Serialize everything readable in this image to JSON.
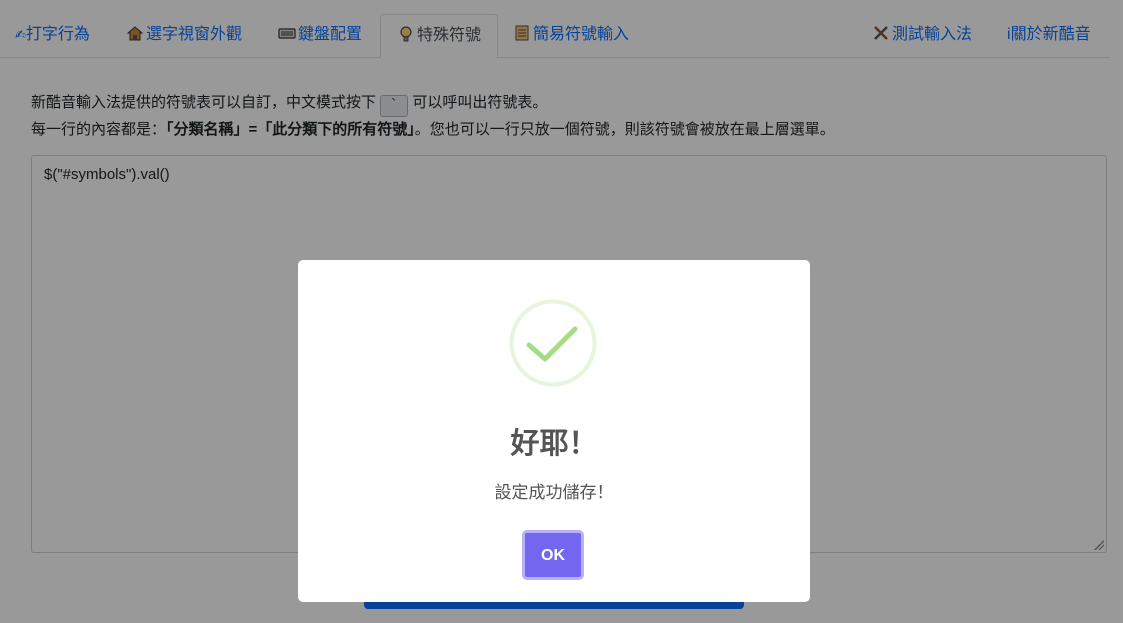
{
  "tabs": [
    {
      "label": "打字行為",
      "icon": "hand-icon"
    },
    {
      "label": "選字視窗外觀",
      "icon": "house-icon"
    },
    {
      "label": "鍵盤配置",
      "icon": "keyboard-icon"
    },
    {
      "label": "特殊符號",
      "icon": "lightbulb-icon",
      "active": true
    },
    {
      "label": "簡易符號輸入",
      "icon": "scroll-icon"
    },
    {
      "label": "測試輸入法",
      "icon": "tools-icon"
    },
    {
      "label": "關於新酷音",
      "icon": "info-icon"
    }
  ],
  "intro": {
    "line1_prefix": "新酷音輸入法提供的符號表可以自訂，中文模式按下",
    "key": "`",
    "line1_suffix": "可以呼叫出符號表。",
    "line2_prefix": "每一行的內容都是：",
    "line2_bold": "「分類名稱」=「此分類下的所有符號」",
    "line2_suffix": "。您也可以一行只放一個符號，則該符號會被放在最上層選單。"
  },
  "editor": {
    "value": "$(\"#symbols\").val()"
  },
  "dialog": {
    "title": "好耶！",
    "text": "設定成功儲存！",
    "ok_label": "OK",
    "icon": "checkmark-icon",
    "accent": "#a5dc86"
  },
  "colors": {
    "link": "#0d6efd",
    "ok_button": "#7367f0"
  }
}
